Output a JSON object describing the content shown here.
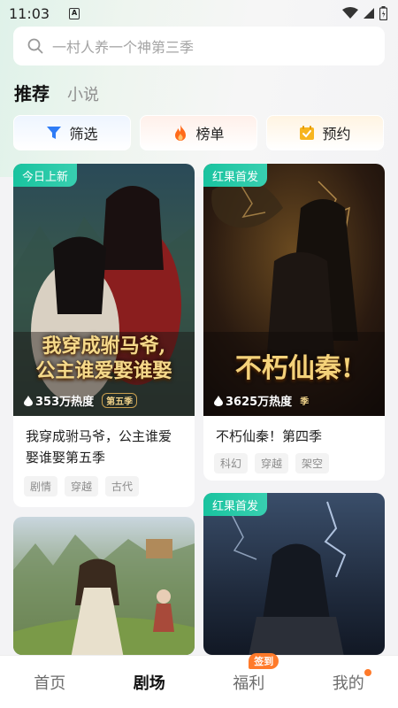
{
  "status_bar": {
    "time": "11:03",
    "a_label": "A"
  },
  "search": {
    "placeholder": "一村人养一个神第三季"
  },
  "tabs": [
    {
      "label": "推荐",
      "active": true
    },
    {
      "label": "小说",
      "active": false
    }
  ],
  "filters": [
    {
      "label": "筛选",
      "icon": "filter-icon"
    },
    {
      "label": "榜单",
      "icon": "flame-icon"
    },
    {
      "label": "预约",
      "icon": "calendar-check-icon"
    }
  ],
  "cards": [
    {
      "badge": "今日上新",
      "heat": "353万热度",
      "art_title_1": "我穿成驸马爷,",
      "art_title_2": "公主谁爱娶谁娶",
      "season_mark": "第五季",
      "title": "我穿成驸马爷，公主谁爱娶谁娶第五季",
      "tags": [
        "剧情",
        "穿越",
        "古代"
      ]
    },
    {
      "badge": "红果首发",
      "heat": "3625万热度",
      "art_title": "不朽仙秦!",
      "season_mark": "季",
      "title": "不朽仙秦！第四季",
      "tags": [
        "科幻",
        "穿越",
        "架空"
      ]
    },
    {
      "badge": ""
    },
    {
      "badge": "红果首发"
    }
  ],
  "bottom_nav": [
    {
      "label": "首页",
      "active": false
    },
    {
      "label": "剧场",
      "active": true
    },
    {
      "label": "福利",
      "active": false,
      "badge": "签到"
    },
    {
      "label": "我的",
      "active": false,
      "dot": true
    }
  ],
  "colors": {
    "badge_green": "#19c39f",
    "accent_orange": "#ff7a2a"
  }
}
